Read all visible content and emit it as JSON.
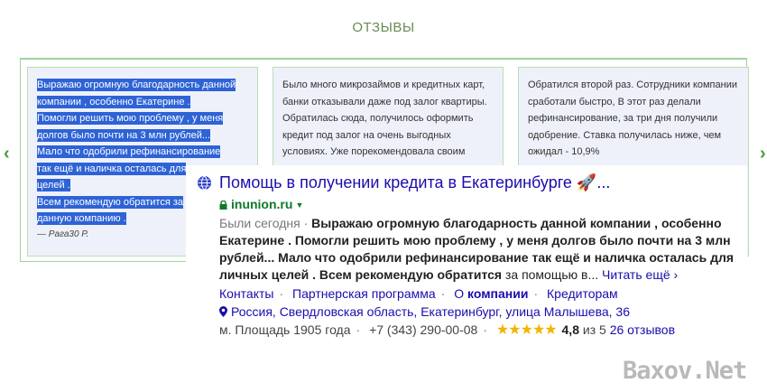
{
  "section": {
    "title": "ОТЗЫВЫ"
  },
  "nav": {
    "left_arrow": "‹",
    "right_arrow": "›"
  },
  "reviews": [
    {
      "selected_lines": [
        "Выражаю огромную благодарность данной",
        "компании , особенно Екатерине .",
        "Помогли решить мою проблему , у меня",
        "долгов было почти на 3 млн рублей...",
        "Мало что одобрили рефинансирование",
        "так ещё и наличка осталась для",
        "целей .",
        "Всем рекомендую обратится за",
        "данную компанию ."
      ],
      "author": "— Рага30 Р."
    },
    {
      "text": "Было много микрозаймов и кредитных карт, банки отказывали даже под залог квартиры. Обратилась сюда, получилось оформить кредит под залог на очень выгодных условиях. Уже порекомендовала своим"
    },
    {
      "text": "Обратился второй раз. Сотрудники компании сработали быстро, В этот раз делали рефинансирование, за три дня получили одобрение. Ставка получилась ниже, чем ожидал - 10,9%"
    }
  ],
  "snippet": {
    "title": "Помощь в получении кредита в Екатеринбурге 🚀...",
    "url": "inunion.ru",
    "date": "Были сегодня",
    "description_bold": "Выражаю огромную благодарность данной компании , особенно Екатерине . Помогли решить мою проблему , у меня долгов было почти на 3 млн рублей... Мало что одобрили рефинансирование так ещё и наличка осталась для личных целей . Всем рекомендую обратится",
    "description_rest": "за помощью в...",
    "read_more": "Читать ещё ›",
    "links": [
      "Контакты",
      "Партнерская программа",
      "О компании",
      "Кредиторам"
    ],
    "links_bold_word": "компании",
    "address": "Россия, Свердловская область, Екатеринбург, улица Малышева, 36",
    "metro": "м. Площадь 1905 года",
    "phone": "+7 (343) 290-00-08",
    "stars": "★★★★★",
    "rating": "4,8",
    "rating_of": "из 5",
    "reviews_count": "26 отзывов"
  },
  "watermark": "Baxov.Net"
}
